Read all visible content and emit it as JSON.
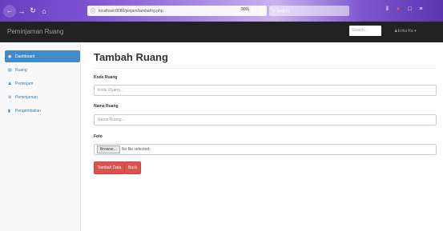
{
  "browser": {
    "url": "localhost:8080/pinjam/tambahrg.php",
    "zoom": "90%",
    "search_placeholder": "Search",
    "back_icon": "arrow-left-icon",
    "forward_icon": "arrow-right-icon",
    "reload_icon": "reload-icon",
    "home_icon": "home-icon"
  },
  "navbar": {
    "brand": "Peminjaman Ruang",
    "search_placeholder": "Search...",
    "user": "Erika Ra"
  },
  "sidebar": {
    "items": [
      {
        "label": "Dashboard",
        "icon": "dashboard-icon",
        "active": true
      },
      {
        "label": "Ruang",
        "icon": "list-icon",
        "active": false
      },
      {
        "label": "Peminjam",
        "icon": "user-icon",
        "active": false
      },
      {
        "label": "Peminjaman",
        "icon": "gear-icon",
        "active": false
      },
      {
        "label": "Pengembalian",
        "icon": "book-icon",
        "active": false
      }
    ]
  },
  "main": {
    "title": "Tambah Ruang",
    "fields": {
      "kode": {
        "label": "Kode Ruang",
        "placeholder": "Kode Ruang..."
      },
      "nama": {
        "label": "Nama Ruang",
        "placeholder": "Nama Ruang..."
      },
      "foto": {
        "label": "Foto",
        "browse": "Browse...",
        "status": "No file selected."
      }
    },
    "buttons": {
      "submit": "Tambah Data",
      "back": "Back"
    }
  },
  "colors": {
    "navbar_bg": "#222222",
    "sidebar_active": "#428bca",
    "button_danger": "#d9534f"
  }
}
